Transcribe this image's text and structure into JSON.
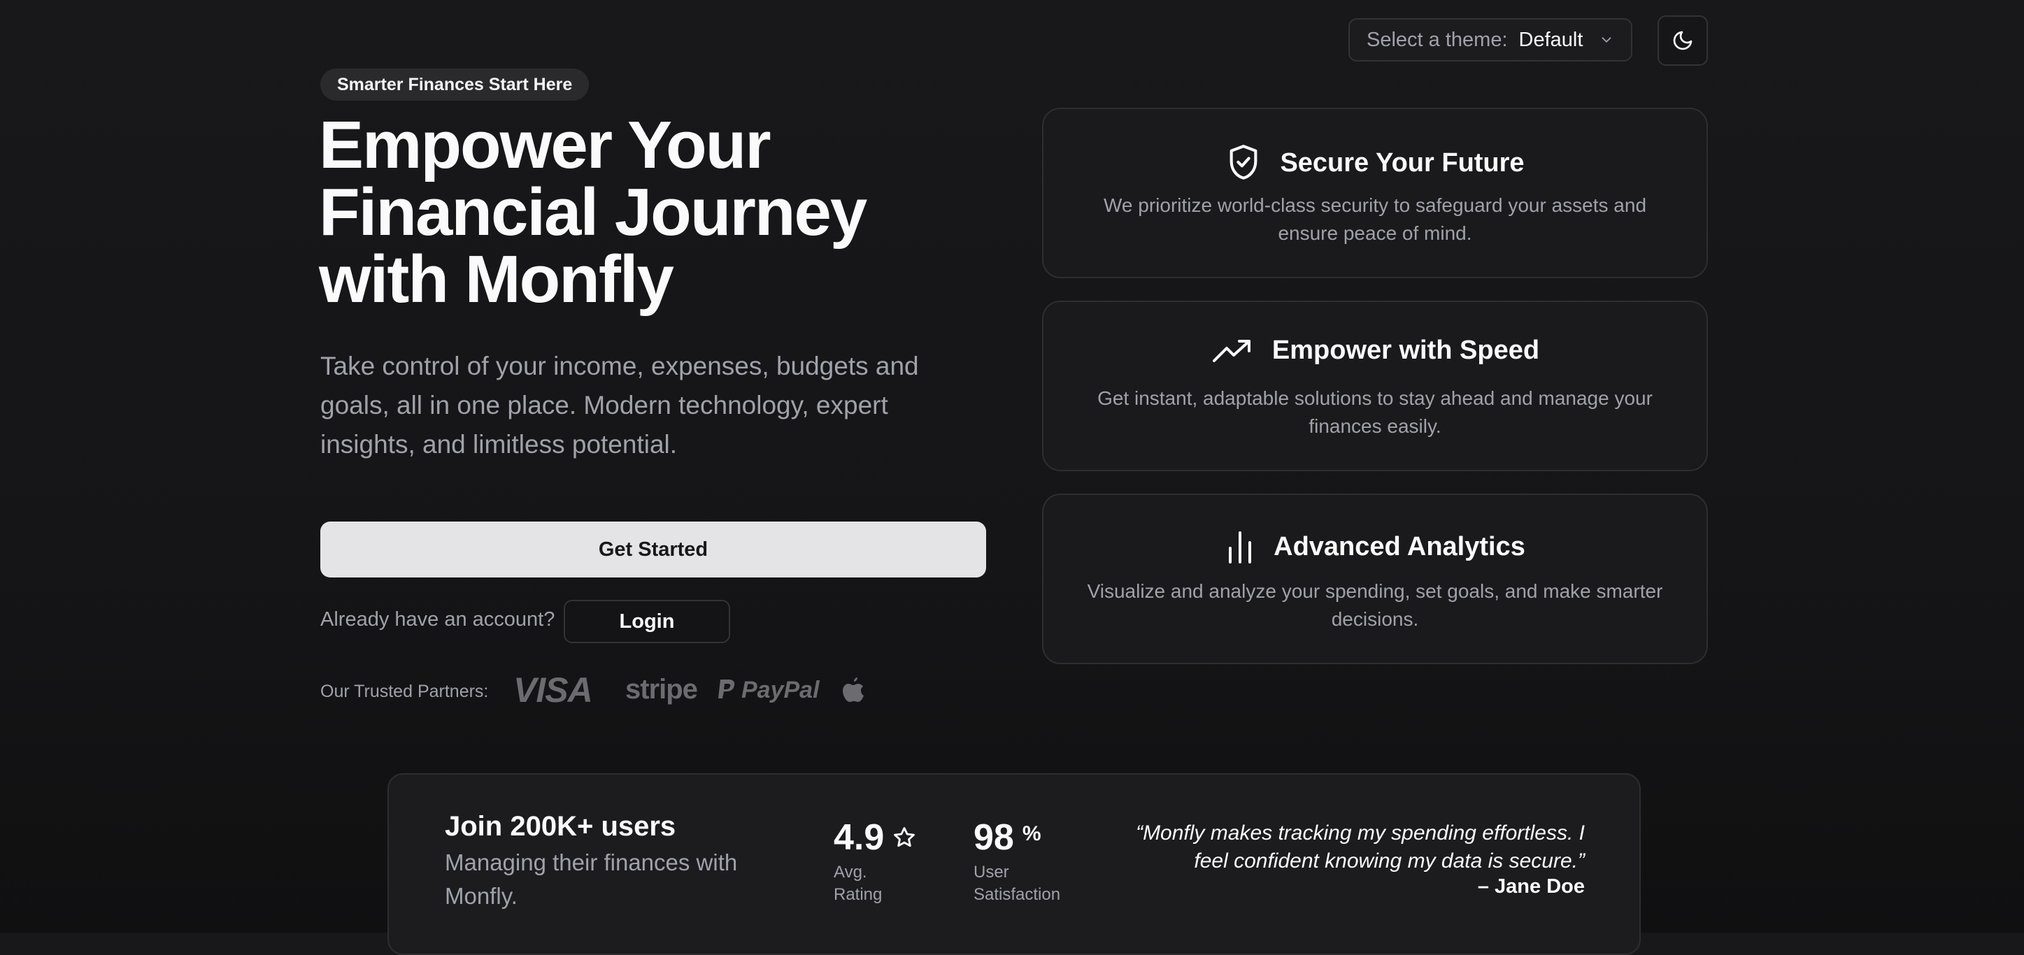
{
  "theme_selector": {
    "label": "Select a theme:",
    "value": "Default"
  },
  "mode_toggle": {
    "icon": "moon-icon"
  },
  "hero": {
    "badge": "Smarter Finances Start Here",
    "title": "Empower Your Financial Journey with Monfly",
    "subtitle": "Take control of your income, expenses, budgets and goals, all in one place. Modern technology, expert insights, and limitless potential.",
    "cta_label": "Get Started",
    "account_prompt": "Already have an account?",
    "login_label": "Login",
    "partners_label": "Our Trusted Partners:",
    "partners": [
      "VISA",
      "stripe",
      "PayPal",
      "apple-logo"
    ]
  },
  "features": [
    {
      "icon": "shield-check-icon",
      "title": "Secure Your Future",
      "description": "We prioritize world-class security to safeguard your assets and ensure peace of mind."
    },
    {
      "icon": "trending-up-icon",
      "title": "Empower with Speed",
      "description": "Get instant, adaptable solutions to stay ahead and manage your finances easily."
    },
    {
      "icon": "bar-chart-icon",
      "title": "Advanced Analytics",
      "description": "Visualize and analyze your spending, set goals, and make smarter decisions."
    }
  ],
  "stats": {
    "join_title": "Join 200K+ users",
    "join_subtitle": "Managing their finances with Monfly.",
    "rating_value": "4.9",
    "rating_label": "Avg. Rating",
    "satisfaction_value": "98",
    "satisfaction_unit": "%",
    "satisfaction_label": "User Satisfaction",
    "quote": "“Monfly makes tracking my spending effortless. I feel confident knowing my data is secure.”",
    "quote_author": "– Jane Doe"
  },
  "colors": {
    "background": "#151517",
    "card": "#1a1a1c",
    "border": "#2e2e31",
    "muted_text": "#a1a1aa",
    "primary_button": "#e4e4e7"
  }
}
